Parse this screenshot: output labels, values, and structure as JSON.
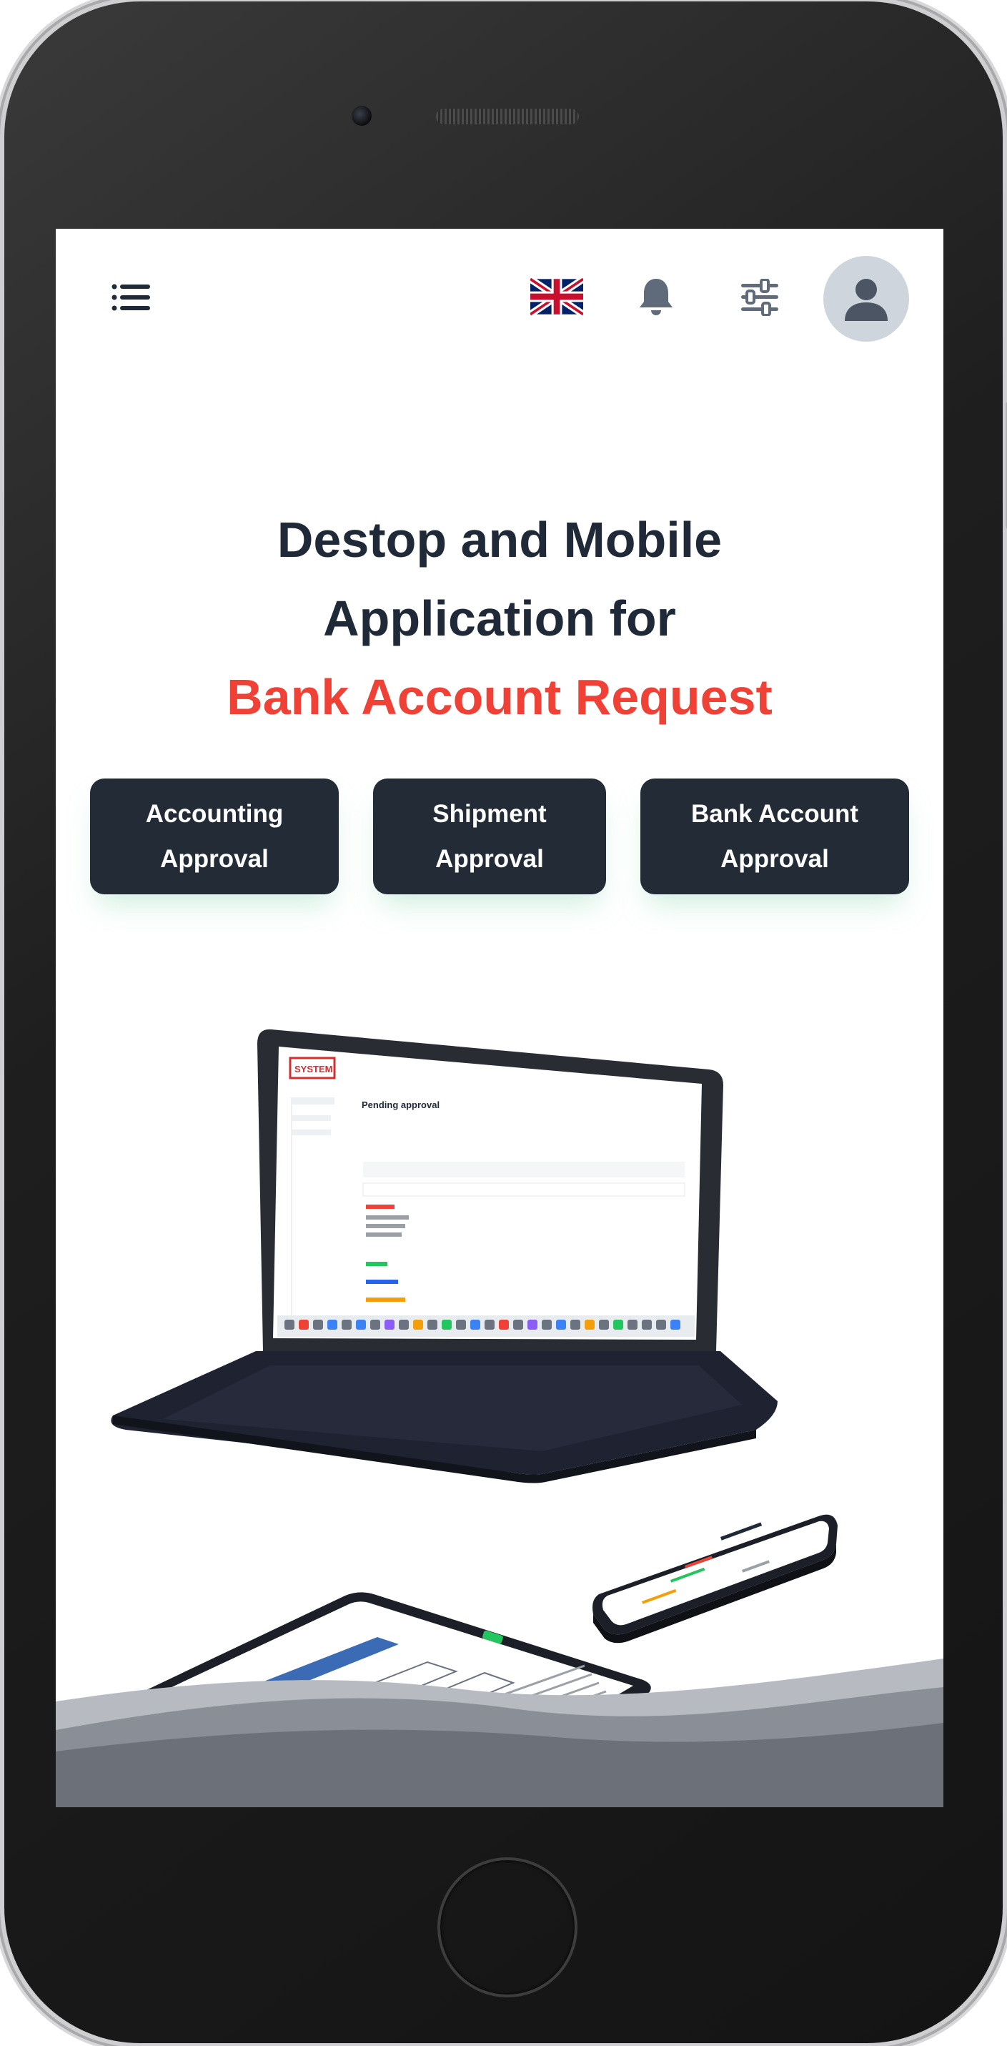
{
  "topbar": {
    "menu_icon": "hamburger-menu-icon",
    "language_icon": "uk-flag-icon",
    "notification_icon": "bell-icon",
    "settings_icon": "sliders-icon",
    "profile_icon": "user-avatar-icon"
  },
  "hero": {
    "line1": "Destop and Mobile",
    "line2": "Application for",
    "accent_line": "Bank Account Request"
  },
  "actions": [
    {
      "line1": "Accounting",
      "line2": "Approval"
    },
    {
      "line1": "Shipment",
      "line2": "Approval"
    },
    {
      "line1": "Bank Account",
      "line2": "Approval"
    }
  ],
  "illustration": {
    "logo_text": "SYSTEM",
    "screen_title": "Pending approval"
  },
  "colors": {
    "accent": "#ef4136",
    "heading": "#1f2937",
    "button_bg": "#222b36",
    "icon_gray": "#5f6b7a",
    "wave": "#6b7079"
  }
}
